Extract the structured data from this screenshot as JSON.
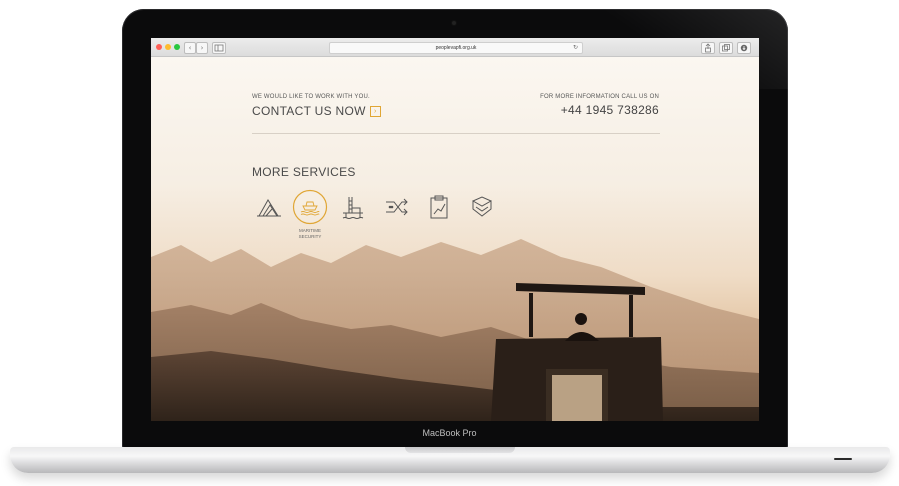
{
  "device": {
    "label": "MacBook Pro"
  },
  "browser": {
    "url": "peoplevapfi.org.uk",
    "back_symbol": "‹",
    "forward_symbol": "›",
    "traffic_light_colors": [
      "#ff5f57",
      "#febc2e",
      "#28c840"
    ]
  },
  "header": {
    "contact_intro": "WE WOULD LIKE TO WORK WITH YOU.",
    "contact_link": "CONTACT US NOW",
    "info_intro": "FOR MORE INFORMATION CALL US ON",
    "phone": "+44 1945 738286"
  },
  "services": {
    "title": "MORE SERVICES",
    "items": [
      {
        "icon": "mountain-icon"
      },
      {
        "icon": "ship-icon",
        "caption_line1": "MARITIME",
        "caption_line2": "SECURITY",
        "active": true
      },
      {
        "icon": "oil-rig-icon"
      },
      {
        "icon": "crossed-arrows-icon"
      },
      {
        "icon": "clipboard-chart-icon"
      },
      {
        "icon": "shield-chevron-icon"
      }
    ]
  },
  "colors": {
    "accent": "#e0a635",
    "text_dark": "#4a4a4a"
  }
}
